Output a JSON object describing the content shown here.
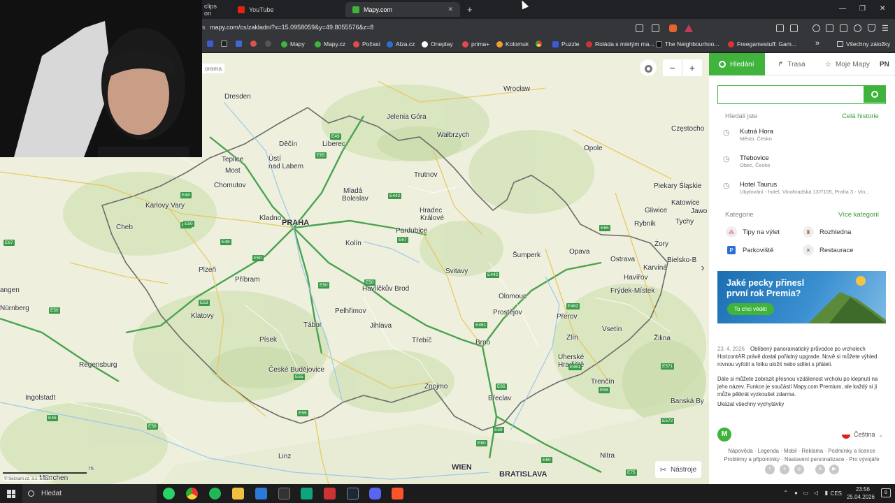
{
  "browser": {
    "tabs": [
      {
        "label": "clips on"
      },
      {
        "label": "YouTube"
      },
      {
        "label": "Mapy.com"
      }
    ],
    "new_tab": "+",
    "address": "mapy.com/cs/zakladni?x=15.0958059&y=49.8055576&z=8",
    "address_prefix": "s",
    "bookmarks": [
      {
        "label": "Mapy"
      },
      {
        "label": "Mapy.cz"
      },
      {
        "label": "Počasí"
      },
      {
        "label": "Alza.cz"
      },
      {
        "label": "Oneplay"
      },
      {
        "label": "prima+"
      },
      {
        "label": "Kolomuk"
      },
      {
        "label": "Puzzle"
      },
      {
        "label": "Roláda s mietým ma..."
      },
      {
        "label": "The Neighbourhoo..."
      },
      {
        "label": "Freegamestuff: Gam..."
      }
    ],
    "bookmarks_overflow": "»",
    "all_bookmarks": "Všechny záložky"
  },
  "map": {
    "panorama_label": "orama",
    "zoom_in": "+",
    "zoom_out": "−",
    "tools_label": "Nástroje",
    "attribution": "© Seznam.cz, a.s. a další",
    "scale_label": "75",
    "expand_arrow": "›",
    "places": {
      "dresden": "Dresden",
      "wroclaw": "Wrocław",
      "czestochowa": "Częstocho",
      "jelenia": "Jelenia Góra",
      "walbrzych": "Wałbrzych",
      "decin": "Děčín",
      "liberec": "Liberec",
      "opole": "Opole",
      "teplice": "Teplice",
      "usti1": "Ústí",
      "usti2": "nad Labem",
      "most": "Most",
      "trutnov": "Trutnov",
      "piekary": "Piekary Śląskie",
      "chomutov": "Chomutov",
      "mlada1": "Mladá",
      "mlada2": "Boleslav",
      "katowice": "Katowice",
      "jaw": "Jawo",
      "karlovy": "Karlovy Vary",
      "hradec1": "Hradec",
      "hradec2": "Králové",
      "gliwice": "Gliwice",
      "kladno": "Kladno",
      "praha": "PRAHA",
      "rybnik": "Rybnik",
      "tychy": "Tychy",
      "cheb": "Cheb",
      "pardubice": "Pardubice",
      "kolin": "Kolín",
      "zory": "Żory",
      "sumperk": "Šumperk",
      "opava": "Opava",
      "ostrava": "Ostrava",
      "bielsko": "Bielsko-B",
      "plzen": "Plzeň",
      "svitavy": "Svitavy",
      "karvina": "Karviná",
      "havirov": "Havířov",
      "pribram": "Příbram",
      "angen": "angen",
      "havlickuv": "Havlíčkův Brod",
      "frydek": "Frýdek-Místek",
      "olomouc": "Olomouc",
      "nurnberg": "Nürnberg",
      "pelhrimov": "Pelhřimov",
      "prostejov": "Prostějov",
      "klatovy": "Klatovy",
      "tabor": "Tábor",
      "prerov": "Přerov",
      "jihlava": "Jihlava",
      "vsetin": "Vsetín",
      "zilina": "Žilina",
      "pisek": "Písek",
      "trebic": "Třebíč",
      "brno": "Brno",
      "zlin": "Zlín",
      "regensburg": "Regensburg",
      "uherske1": "Uherské",
      "uherske2": "Hradiště",
      "ceske": "České Budějovice",
      "trencin": "Trenčín",
      "znojmo": "Znojmo",
      "ingolstadt": "Ingolstadt",
      "breclav": "Břeclav",
      "banska": "Banská By",
      "linz": "Linz",
      "nitra": "Nitra",
      "wien": "WIEN",
      "munchen": "München",
      "bratislava": "BRATISLAVA"
    },
    "roads": [
      "E49",
      "E442",
      "E442",
      "E48",
      "E48",
      "E65",
      "E48",
      "E67",
      "E50",
      "E50",
      "E53",
      "E50",
      "E55",
      "E59",
      "E461",
      "E462",
      "E65",
      "E65",
      "E55",
      "E50",
      "E45",
      "E56",
      "E461",
      "E60",
      "E58",
      "E75",
      "E571",
      "E572",
      "E60",
      "E67",
      "E50"
    ]
  },
  "sidebar": {
    "tabs": {
      "search": "Hledání",
      "route": "Trasa",
      "my_maps": "Moje Mapy",
      "user": "PN"
    },
    "search_placeholder": "",
    "history_title": "Hledali jste",
    "history_link": "Celá historie",
    "history": [
      {
        "name": "Kutná Hora",
        "sub": "Město, Česko"
      },
      {
        "name": "Třebovice",
        "sub": "Obec, Česko"
      },
      {
        "name": "Hotel Taurus",
        "sub": "Ubytování - hotel, Vinohradská 137/105, Praha 3 - Vin..."
      }
    ],
    "categories_title": "Kategorie",
    "categories_link": "Více kategorií",
    "categories": [
      {
        "label": "Tipy na výlet"
      },
      {
        "label": "Rozhledna"
      },
      {
        "label": "Parkoviště"
      },
      {
        "label": "Restaurace"
      }
    ],
    "promo": {
      "title_1": "Jaké pecky přinesl",
      "title_2": "první rok Premia?",
      "button": "To chci vědět"
    },
    "news": {
      "date": "23. 4. 2026",
      "text1": "Oblíbený panoramatický průvodce po vrcholech HorizontAR právě dostal pořádný upgrade. Nově si můžete výhled rovnou vyfotit a fotku uložit nebo sdílet s přáteli.",
      "text2": "Dále si můžete zobrazit přesnou vzdálenost vrcholu po klepnutí na jeho název. Funkce je součástí Mapy.com Premium, ale každý si ji může pětkrát vyzkoušet zdarma.",
      "link": "Ukázat všechny vychytávky"
    },
    "language": "Čeština",
    "logo": "M",
    "footer_line1": "Nápověda · Legenda · Mobil · Reklama · Podmínky a licence",
    "footer_line2": "Problémy a připomínky · Nastavení personalizace · Pro vývojáře"
  },
  "taskbar": {
    "search": "Hledat",
    "lang": "CES",
    "time": "23:56",
    "date": "25.04.2026",
    "notif": "8"
  },
  "colors": {
    "accent": "#3fb33b",
    "map_bg": "#eef0dd",
    "border": "#6b6b6b"
  }
}
